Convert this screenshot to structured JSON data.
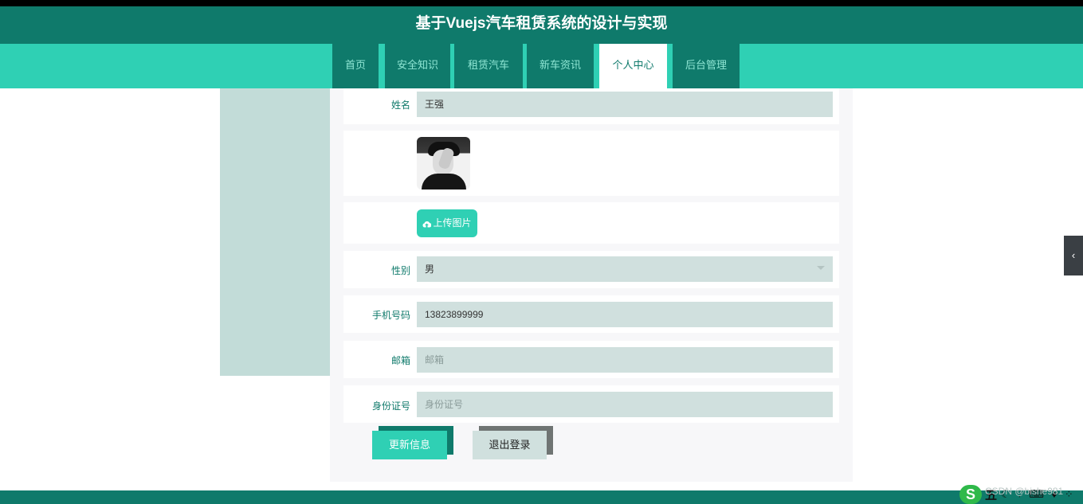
{
  "header": {
    "title": "基于Vuejs汽车租赁系统的设计与实现"
  },
  "nav": {
    "items": [
      {
        "label": "首页"
      },
      {
        "label": "安全知识"
      },
      {
        "label": "租赁汽车"
      },
      {
        "label": "新车资讯"
      },
      {
        "label": "个人中心",
        "active": true
      },
      {
        "label": "后台管理"
      }
    ]
  },
  "form": {
    "name": {
      "label": "姓名",
      "value": "王强"
    },
    "avatar": {
      "icon": "avatar-photo"
    },
    "upload": {
      "label": "上传图片",
      "icon": "cloud-upload-icon"
    },
    "gender": {
      "label": "性别",
      "value": "男"
    },
    "phone": {
      "label": "手机号码",
      "value": "13823899999"
    },
    "email": {
      "label": "邮箱",
      "placeholder": "邮箱",
      "value": ""
    },
    "id_card": {
      "label": "身份证号",
      "placeholder": "身份证号",
      "value": ""
    }
  },
  "actions": {
    "update_label": "更新信息",
    "logout_label": "退出登录"
  },
  "overlay": {
    "ime_logo": "S",
    "ime_mode": "五",
    "watermark": "CSDN @bishe981"
  },
  "colors": {
    "primary_dark": "#0f7a6b",
    "primary": "#2fd0b4",
    "field_bg": "#d0e0de"
  }
}
